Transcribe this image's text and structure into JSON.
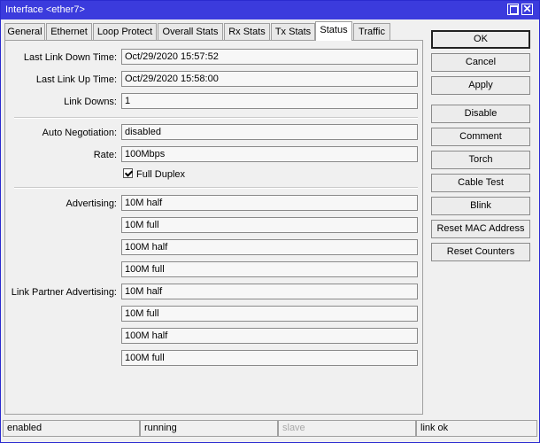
{
  "window": {
    "title": "Interface <ether7>"
  },
  "tabs": [
    {
      "label": "General"
    },
    {
      "label": "Ethernet"
    },
    {
      "label": "Loop Protect"
    },
    {
      "label": "Overall Stats"
    },
    {
      "label": "Rx Stats"
    },
    {
      "label": "Tx Stats"
    },
    {
      "label": "Status",
      "active": true
    },
    {
      "label": "Traffic"
    }
  ],
  "status": {
    "last_link_down_label": "Last Link Down Time:",
    "last_link_down_value": "Oct/29/2020 15:57:52",
    "last_link_up_label": "Last Link Up Time:",
    "last_link_up_value": "Oct/29/2020 15:58:00",
    "link_downs_label": "Link Downs:",
    "link_downs_value": "1",
    "auto_negotiation_label": "Auto Negotiation:",
    "auto_negotiation_value": "disabled",
    "rate_label": "Rate:",
    "rate_value": "100Mbps",
    "full_duplex_label": "Full Duplex",
    "full_duplex_checked": true,
    "advertising_label": "Advertising:",
    "advertising": [
      "10M half",
      "10M full",
      "100M half",
      "100M full"
    ],
    "partner_advertising_label": "Link Partner Advertising:",
    "partner_advertising": [
      "10M half",
      "10M full",
      "100M half",
      "100M full"
    ]
  },
  "buttons": {
    "ok": "OK",
    "cancel": "Cancel",
    "apply": "Apply",
    "disable": "Disable",
    "comment": "Comment",
    "torch": "Torch",
    "cable_test": "Cable Test",
    "blink": "Blink",
    "reset_mac": "Reset MAC Address",
    "reset_counters": "Reset Counters"
  },
  "statusbar": {
    "enabled": "enabled",
    "running": "running",
    "slave": "slave",
    "link": "link ok"
  }
}
